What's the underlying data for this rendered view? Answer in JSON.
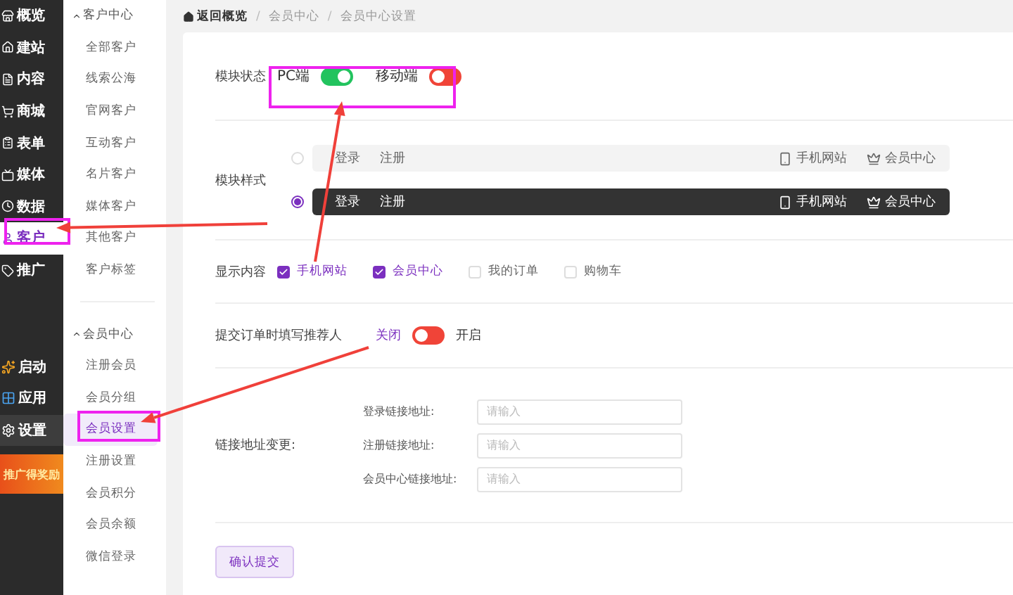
{
  "main_nav": {
    "items": [
      {
        "label": "概览",
        "selected": false
      },
      {
        "label": "建站",
        "selected": false
      },
      {
        "label": "内容",
        "selected": false
      },
      {
        "label": "商城",
        "selected": false
      },
      {
        "label": "表单",
        "selected": false
      },
      {
        "label": "媒体",
        "selected": false
      },
      {
        "label": "数据",
        "selected": false
      },
      {
        "label": "客户",
        "selected": true
      },
      {
        "label": "推广",
        "selected": false
      }
    ],
    "bottom_items": [
      {
        "label": "启动",
        "selected": false
      },
      {
        "label": "应用",
        "selected": false
      },
      {
        "label": "设置",
        "selected": true
      }
    ],
    "promo_banner": {
      "text": "推广得奖励"
    }
  },
  "sub_nav": {
    "sections": [
      {
        "title": "客户中心",
        "expanded": true,
        "items": [
          {
            "label": "全部客户",
            "selected": false
          },
          {
            "label": "线索公海",
            "selected": false
          },
          {
            "label": "官网客户",
            "selected": false
          },
          {
            "label": "互动客户",
            "selected": false
          },
          {
            "label": "名片客户",
            "selected": false
          },
          {
            "label": "媒体客户",
            "selected": false
          },
          {
            "label": "其他客户",
            "selected": false
          },
          {
            "label": "客户标签",
            "selected": false
          }
        ]
      },
      {
        "title": "会员中心",
        "expanded": true,
        "items": [
          {
            "label": "注册会员",
            "selected": false
          },
          {
            "label": "会员分组",
            "selected": false
          },
          {
            "label": "会员设置",
            "selected": true
          },
          {
            "label": "注册设置",
            "selected": false
          },
          {
            "label": "会员积分",
            "selected": false
          },
          {
            "label": "会员余额",
            "selected": false
          },
          {
            "label": "微信登录",
            "selected": false
          }
        ]
      }
    ]
  },
  "breadcrumb": {
    "items": [
      "返回概览",
      "会员中心",
      "会员中心设置"
    ],
    "separator": "/"
  },
  "module_status": {
    "label": "模块状态",
    "switches": [
      {
        "label": "PC端",
        "on": true
      },
      {
        "label": "移动端",
        "on": false
      }
    ]
  },
  "module_style": {
    "label": "模块样式",
    "options": [
      {
        "kind": "light",
        "selected": false,
        "links": [
          "登录",
          "注册"
        ],
        "right_links": [
          "手机网站",
          "会员中心"
        ]
      },
      {
        "kind": "dark",
        "selected": true,
        "links": [
          "登录",
          "注册"
        ],
        "right_links": [
          "手机网站",
          "会员中心"
        ]
      }
    ]
  },
  "display_content": {
    "label": "显示内容",
    "options": [
      {
        "label": "手机网站",
        "checked": true
      },
      {
        "label": "会员中心",
        "checked": true
      },
      {
        "label": "我的订单",
        "checked": false
      },
      {
        "label": "购物车",
        "checked": false
      }
    ]
  },
  "referrer": {
    "label": "提交订单时填写推荐人",
    "off_label": "关闭",
    "on_label": "开启",
    "on": false
  },
  "link_change": {
    "label": "链接地址变更:",
    "fields": [
      {
        "label": "登录链接地址:",
        "placeholder": "请输入"
      },
      {
        "label": "注册链接地址:",
        "placeholder": "请输入"
      },
      {
        "label": "会员中心链接地址:",
        "placeholder": "请输入"
      }
    ]
  },
  "submit_button": "确认提交"
}
